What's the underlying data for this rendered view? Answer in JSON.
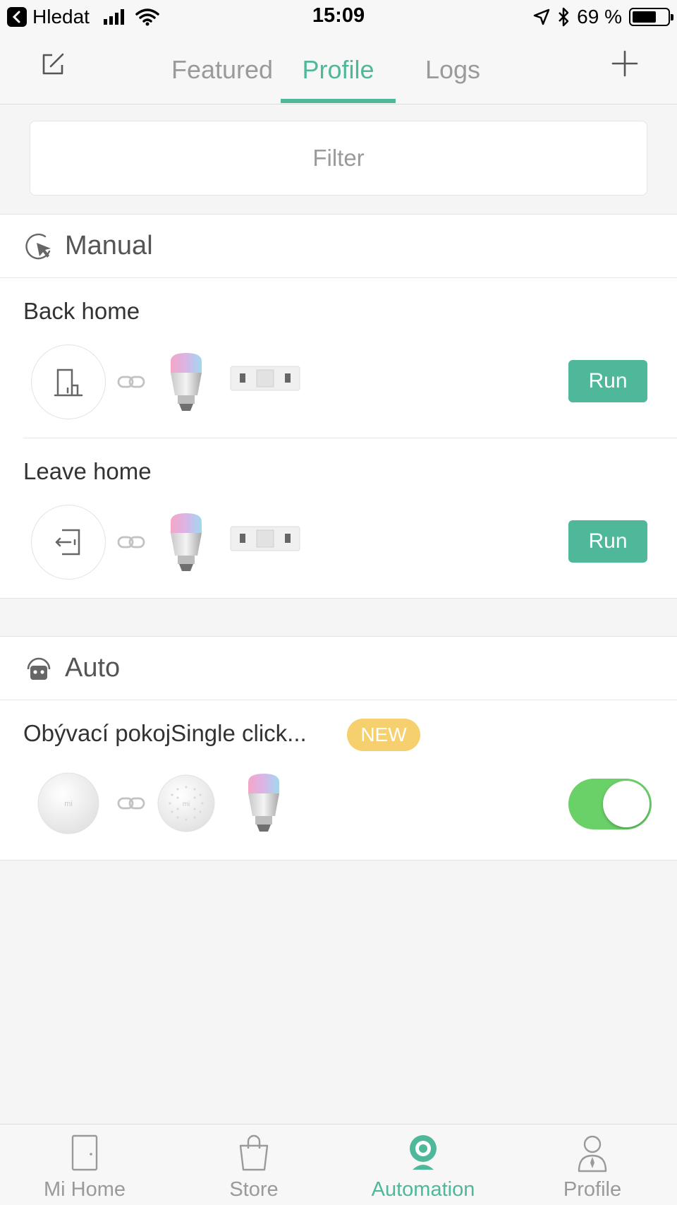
{
  "status_bar": {
    "back_label": "Hledat",
    "time": "15:09",
    "battery": "69 %",
    "battery_level": 0.69
  },
  "nav": {
    "tabs": [
      {
        "label": "Featured",
        "active": false
      },
      {
        "label": "Profile",
        "active": true
      },
      {
        "label": "Logs",
        "active": false
      }
    ]
  },
  "filter": {
    "placeholder": "Filter"
  },
  "manual": {
    "title": "Manual",
    "scenes": [
      {
        "name": "Back home",
        "action": "Run"
      },
      {
        "name": "Leave home",
        "action": "Run"
      }
    ]
  },
  "auto": {
    "title": "Auto",
    "scenes": [
      {
        "name": "Obývací pokojSingle click...",
        "badge": "NEW",
        "enabled": true
      }
    ]
  },
  "tabbar": {
    "items": [
      {
        "label": "Mi Home",
        "icon": "door-icon",
        "active": false
      },
      {
        "label": "Store",
        "icon": "bag-icon",
        "active": false
      },
      {
        "label": "Automation",
        "icon": "camera-icon",
        "active": true
      },
      {
        "label": "Profile",
        "icon": "person-icon",
        "active": false
      }
    ]
  },
  "colors": {
    "accent": "#4fb89a",
    "toggle_on": "#6ad068",
    "badge_new": "#f6d06f"
  }
}
